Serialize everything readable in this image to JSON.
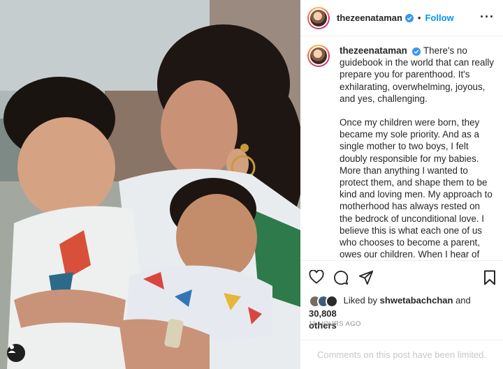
{
  "post": {
    "author": "thezeenataman",
    "verified": true,
    "follow_label": "Follow",
    "header_separator": "•",
    "more_icon": "more-horizontal-icon"
  },
  "caption": {
    "username": "thezeenataman",
    "paragraph_1": "There's no guidebook in the world that can really prepare you for parenthood. It's exhilarating, overwhelming, joyous, and yes, challenging.",
    "paragraph_2": "Once my children were born, they became my sole priority. And as a single mother to two boys, I felt doubly responsible for my babies. More than anything I wanted to protect them, and shape them to be kind and loving men. My approach to motherhood has always rested on the bedrock of unconditional love. I believe this is what each one of us who chooses to become a parent, owes our children. When I hear of people rejecting their kids for reasons"
  },
  "actions": {
    "like_icon": "heart-icon",
    "comment_icon": "comment-icon",
    "share_icon": "share-icon",
    "save_icon": "bookmark-icon"
  },
  "likes": {
    "prefix": "Liked by",
    "liked_by_user": "shwetabachchan",
    "conjunction": "and",
    "count": "30,808",
    "suffix": "others"
  },
  "timestamp": "11 HOURS AGO",
  "comments_note": "Comments on this post have been limited.",
  "colors": {
    "accent_blue": "#0095f6",
    "verified_blue": "#3897f0",
    "muted_gray": "#8e8e8e"
  }
}
